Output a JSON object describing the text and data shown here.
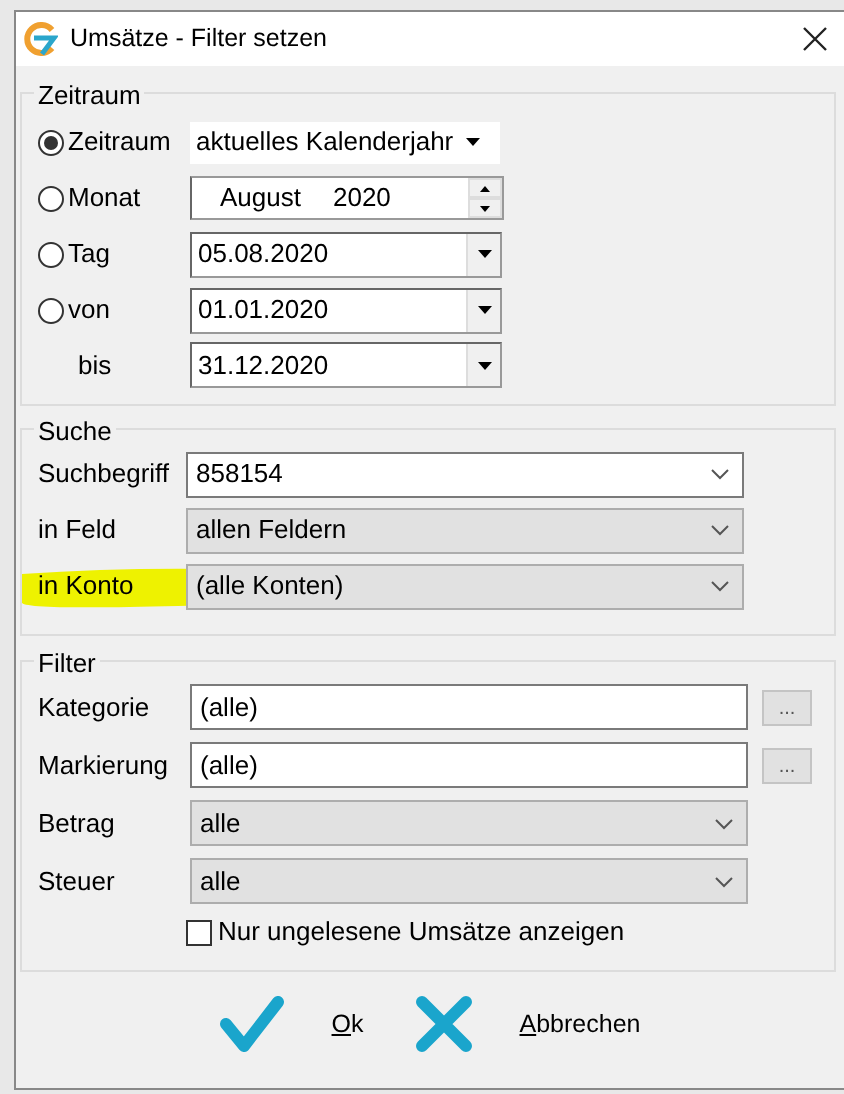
{
  "window": {
    "title": "Umsätze - Filter setzen"
  },
  "zeitraum": {
    "title": "Zeitraum",
    "options": [
      {
        "label": "Zeitraum",
        "selected": true,
        "kind": "combo",
        "value": "aktuelles Kalenderjahr"
      },
      {
        "label": "Monat",
        "selected": false,
        "kind": "spinner",
        "month": "August",
        "year": "2020"
      },
      {
        "label": "Tag",
        "selected": false,
        "kind": "date",
        "value": "05.08.2020"
      },
      {
        "label": "von",
        "selected": false,
        "kind": "date",
        "value": "01.01.2020"
      }
    ],
    "bis": {
      "label": "bis",
      "value": "31.12.2020"
    }
  },
  "suche": {
    "title": "Suche",
    "rows": [
      {
        "label": "Suchbegriff",
        "value": "858154",
        "kind": "edit",
        "highlighted": false
      },
      {
        "label": "in Feld",
        "value": "allen Feldern",
        "kind": "select",
        "highlighted": false
      },
      {
        "label": "in Konto",
        "value": "(alle Konten)",
        "kind": "select",
        "highlighted": true
      }
    ]
  },
  "filter": {
    "title": "Filter",
    "rows": [
      {
        "label": "Kategorie",
        "value": "(alle)",
        "kind": "browse",
        "button": "..."
      },
      {
        "label": "Markierung",
        "value": "(alle)",
        "kind": "browse",
        "button": "..."
      },
      {
        "label": "Betrag",
        "value": "alle",
        "kind": "select"
      },
      {
        "label": "Steuer",
        "value": "alle",
        "kind": "select"
      }
    ],
    "checkbox": {
      "label": "Nur ungelesene Umsätze anzeigen",
      "checked": false
    }
  },
  "buttons": [
    {
      "label": "Ok",
      "kind": "ok"
    },
    {
      "label": "Abbrechen",
      "kind": "cancel"
    }
  ]
}
